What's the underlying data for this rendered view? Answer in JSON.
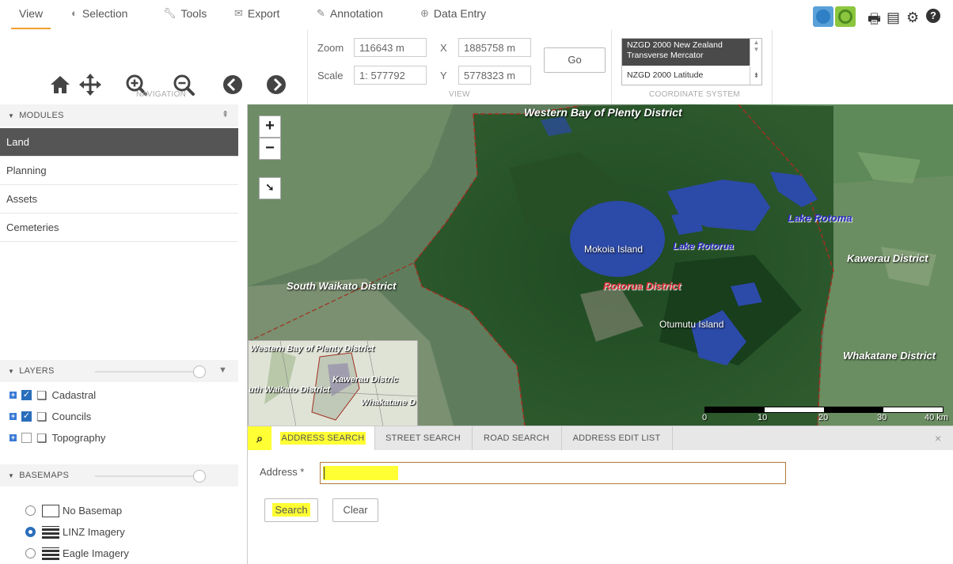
{
  "menu": {
    "items": [
      {
        "label": "View",
        "icon": ""
      },
      {
        "label": "Selection",
        "icon": "selection-icon"
      },
      {
        "label": "Tools",
        "icon": "wrench-icon"
      },
      {
        "label": "Export",
        "icon": "envelope-icon"
      },
      {
        "label": "Annotation",
        "icon": "pencil-icon"
      },
      {
        "label": "Data Entry",
        "icon": "plus-circle-icon"
      }
    ]
  },
  "ribbon": {
    "navigation_caption": "NAVIGATION",
    "view_caption": "VIEW",
    "coordinate_caption": "COORDINATE SYSTEM",
    "zoom_label": "Zoom",
    "zoom_value": "116643 m",
    "scale_label": "Scale",
    "scale_value": "1: 577792",
    "x_label": "X",
    "x_value": "1885758 m",
    "y_label": "Y",
    "y_value": "5778323 m",
    "go_label": "Go",
    "coordinate_selected": "NZGD 2000 New Zealand Transverse Mercator",
    "coordinate_option": "NZGD 2000 Latitude"
  },
  "modules": {
    "title": "MODULES",
    "items": [
      "Land",
      "Planning",
      "Assets",
      "Cemeteries"
    ],
    "selected": "Land"
  },
  "layers": {
    "title": "LAYERS",
    "items": [
      {
        "label": "Cadastral",
        "checked": true
      },
      {
        "label": "Councils",
        "checked": true
      },
      {
        "label": "Topography",
        "checked": false
      }
    ]
  },
  "basemaps": {
    "title": "BASEMAPS",
    "items": [
      {
        "label": "No Basemap",
        "selected": false
      },
      {
        "label": "LINZ Imagery",
        "selected": true
      },
      {
        "label": "Eagle Imagery",
        "selected": false
      }
    ]
  },
  "map": {
    "labels": {
      "western_bop": "Western Bay of Plenty District",
      "lake_rotoma": "Lake Rotoma",
      "kawerau": "Kawerau District",
      "mokoia": "Mokoia Island",
      "lake_rotorua": "Lake Rotorua",
      "south_waikato": "South Waikato District",
      "rotorua": "Rotorua District",
      "otumutu": "Otumutu Island",
      "whakatane": "Whakatane District"
    },
    "overview_labels": {
      "western_bop": "Western Bay of Plenty District",
      "south_waikato": "uth Waikato District",
      "kawerau": "Kawerau Distric",
      "whakatane": "Whakatane D"
    },
    "scale_ticks": [
      "0",
      "10",
      "20",
      "30",
      "40 km"
    ]
  },
  "search": {
    "tabs": [
      "ADDRESS SEARCH",
      "STREET SEARCH",
      "ROAD SEARCH",
      "ADDRESS EDIT LIST"
    ],
    "active_tab": "ADDRESS SEARCH",
    "address_label": "Address *",
    "address_value": "",
    "search_button": "Search",
    "clear_button": "Clear",
    "close_glyph": "×"
  },
  "colors": {
    "accent": "#f0a030",
    "highlight": "#ffff33",
    "selected_module": "#555555",
    "district_boundary": "#a03020",
    "lake": "#2c4aa8"
  }
}
